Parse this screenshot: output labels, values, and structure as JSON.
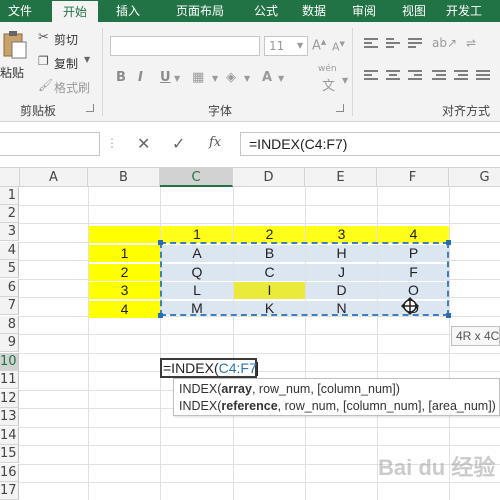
{
  "tabs": [
    "文件",
    "开始",
    "插入",
    "页面布局",
    "公式",
    "数据",
    "审阅",
    "视图",
    "开发工"
  ],
  "active_tab": "开始",
  "ribbon": {
    "paste_label": "粘贴",
    "cut_label": "剪切",
    "copy_label": "复制",
    "format_painter_label": "格式刷",
    "clipboard_group": "剪贴板",
    "font_group": "字体",
    "align_group": "对齐方式",
    "font_size": "11",
    "bold": "B",
    "italic": "I",
    "underline": "U",
    "wen_label": "wén",
    "wen_char": "文"
  },
  "formula_bar": {
    "fx_label": "fx",
    "formula": "=INDEX(C4:F7)"
  },
  "columns": [
    "A",
    "B",
    "C",
    "D",
    "E",
    "F",
    "G"
  ],
  "selected_column": "C",
  "rows": [
    "1",
    "2",
    "3",
    "4",
    "5",
    "6",
    "7",
    "8",
    "9",
    "10",
    "11",
    "12",
    "13",
    "14",
    "15",
    "16",
    "17"
  ],
  "selected_row": "10",
  "table": {
    "col_headers": [
      "1",
      "2",
      "3",
      "4"
    ],
    "row_headers": [
      "1",
      "2",
      "3",
      "4"
    ],
    "cells": [
      [
        "A",
        "B",
        "H",
        "P"
      ],
      [
        "Q",
        "C",
        "J",
        "F"
      ],
      [
        "L",
        "I",
        "D",
        "O"
      ],
      [
        "M",
        "K",
        "N",
        "O"
      ]
    ]
  },
  "edit_cell": {
    "prefix": "=INDEX(",
    "range": "C4:F7"
  },
  "tooltip": {
    "line1_prefix": "INDEX(",
    "line1_bold": "array",
    "line1_rest": ", row_num, [column_num])",
    "line2_prefix": "INDEX(",
    "line2_bold": "reference",
    "line2_rest": ", row_num, [column_num], [area_num])"
  },
  "size_tip": "4R x 4C",
  "watermark": "Bai du 经验",
  "colors": {
    "excel_green": "#217346",
    "yellow": "#ffff00",
    "selection_blue": "#dce6f1",
    "range_blue": "#2e75b6"
  }
}
